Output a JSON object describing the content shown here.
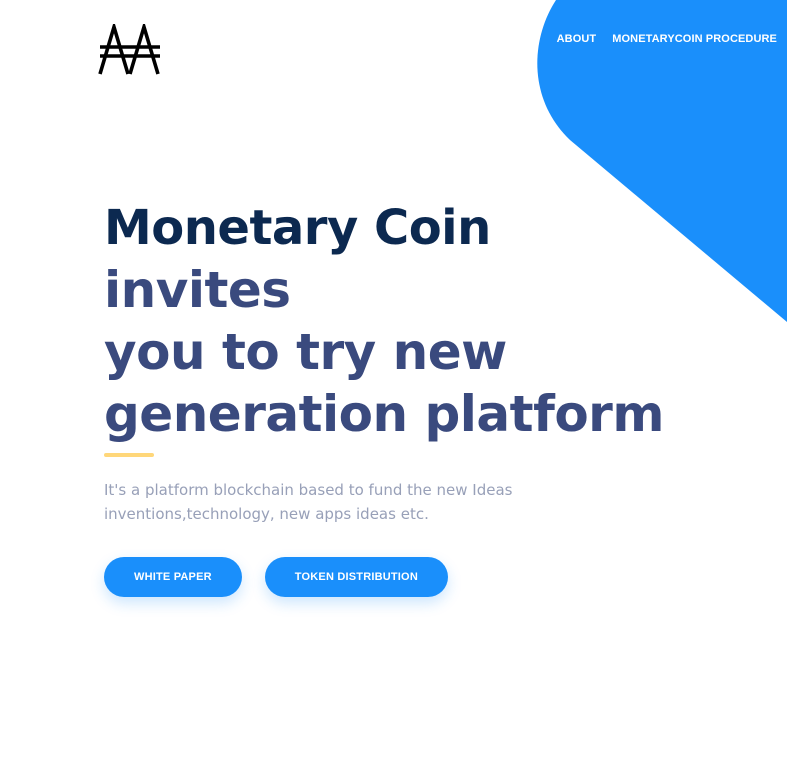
{
  "colors": {
    "accent_blue": "#1a8ffb",
    "heading_dark": "#0c2950",
    "heading_blue": "#3a4a7e",
    "body_text": "#98a0b8",
    "underline_yellow": "#ffd77a"
  },
  "header": {
    "logo_icon": "double-a-logo",
    "nav": [
      {
        "label": "ABOUT"
      },
      {
        "label": "MONETARYCOIN PROCEDURE"
      }
    ]
  },
  "hero": {
    "title_brand": "Monetary Coin",
    "title_line2": "invites",
    "title_line3": "you to try new",
    "title_line4": "generation platform",
    "description_line1": "It's a platform blockchain based to fund the new Ideas",
    "description_line2": "inventions,technology, new apps ideas etc.",
    "buttons": [
      {
        "label": "WHITE PAPER"
      },
      {
        "label": "TOKEN DISTRIBUTION"
      }
    ]
  }
}
